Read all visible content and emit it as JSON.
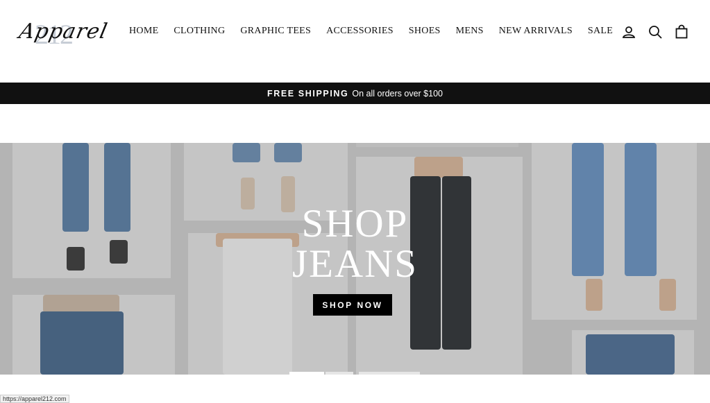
{
  "brand": {
    "logo_script": "Apparel",
    "logo_number": "212"
  },
  "nav": {
    "items": [
      {
        "label": "HOME"
      },
      {
        "label": "CLOTHING"
      },
      {
        "label": "GRAPHIC TEES"
      },
      {
        "label": "ACCESSORIES"
      },
      {
        "label": "SHOES"
      },
      {
        "label": "MENS"
      },
      {
        "label": "NEW ARRIVALS"
      },
      {
        "label": "SALE"
      }
    ]
  },
  "header_icons": [
    "account-icon",
    "search-icon",
    "cart-icon"
  ],
  "announcement": {
    "strong": "FREE SHIPPING",
    "text": "On all orders over $100"
  },
  "hero": {
    "title_line1": "SHOP",
    "title_line2": "JEANS",
    "button_label": "SHOP NOW",
    "slides": 3,
    "active_slide": 1
  },
  "status_bar": {
    "url": "https://apparel212.com"
  },
  "colors": {
    "announce_bg": "#111111",
    "button_bg": "#000000",
    "denim_mid": "#5b7fa6",
    "denim_dark": "#2f3236"
  }
}
